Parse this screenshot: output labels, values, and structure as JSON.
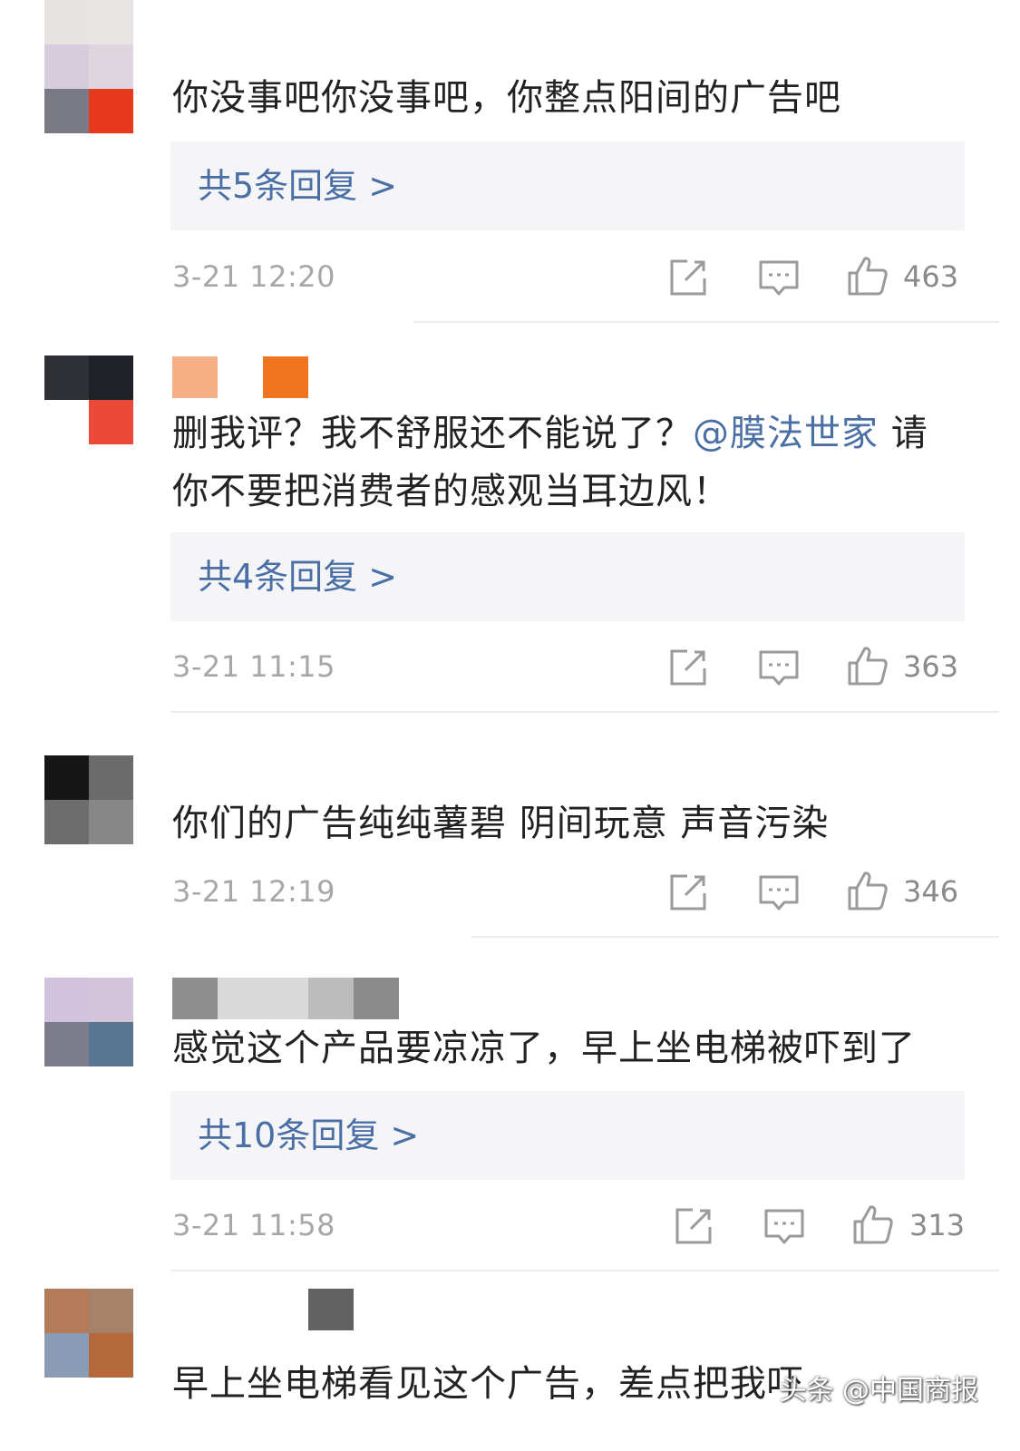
{
  "comments": [
    {
      "text": "你没事吧你没事吧，你整点阳间的广告吧",
      "reply_label": "共5条回复 >",
      "time": "3-21 12:20",
      "likes": "463",
      "avatar_colors": [
        "#e6e3e1",
        "#e7e4e3",
        "#d6cddc",
        "#ddd6de",
        "#7a7a85",
        "#e8391e"
      ]
    },
    {
      "text_before_mention": "删我评？我不舒服还不能说了？",
      "mention": "@膜法世家",
      "text_after_mention": " 请",
      "text_line2": "你不要把消费者的感观当耳边风！",
      "reply_label": "共4条回复 >",
      "time": "3-21 11:15",
      "likes": "363",
      "avatar_colors": [
        "#2e3036",
        "#1f2227",
        "#ffffff",
        "#ea4a37"
      ]
    },
    {
      "text": "你们的广告纯纯薯碧 阴间玩意 声音污染",
      "time": "3-21 12:19",
      "likes": "346",
      "avatar_colors": [
        "#161616",
        "#6b6b6b",
        "#6d6d6d",
        "#878787"
      ]
    },
    {
      "text": "感觉这个产品要凉凉了，早上坐电梯被吓到了",
      "reply_label": "共10条回复 >",
      "time": "3-21 11:58",
      "likes": "313",
      "avatar_colors": [
        "#d1c2de",
        "#d3c4dc",
        "#7d7c8a",
        "#5a7592"
      ]
    },
    {
      "text": "早上坐电梯看见这个广告，差点把我吓",
      "avatar_colors": [
        "#b47b58",
        "#a7826a",
        "#8a9bb5",
        "#b5693a"
      ]
    }
  ],
  "watermark": "头条 @中国商报",
  "colors": {
    "link": "#4a6fa5",
    "time": "#a7a7a7",
    "reply_bg": "#f5f5f7"
  },
  "icons": [
    "share-icon",
    "comment-icon",
    "like-icon"
  ]
}
